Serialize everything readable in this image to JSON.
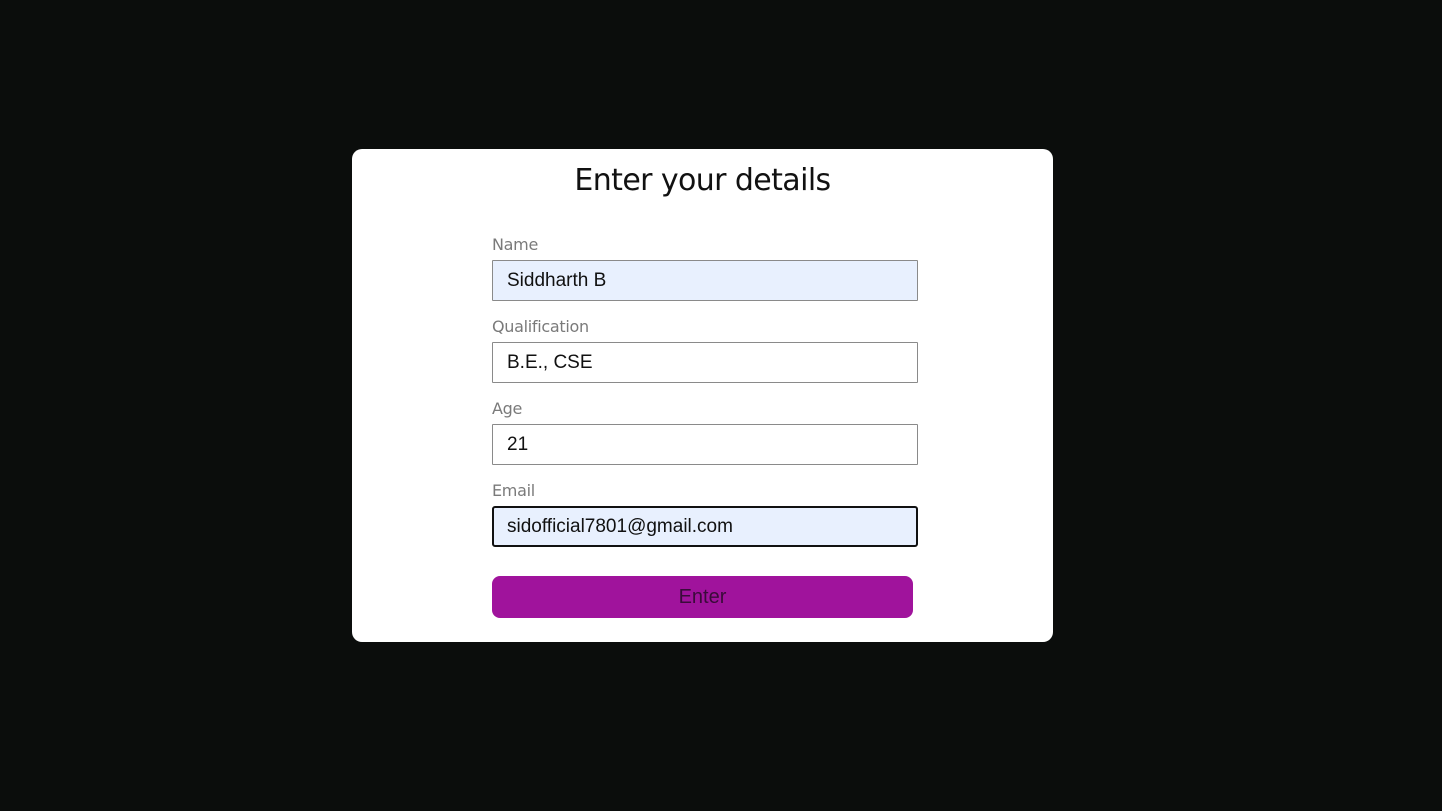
{
  "form": {
    "title": "Enter your details",
    "fields": [
      {
        "label": "Name",
        "value": "Siddharth B",
        "state": "autofilled"
      },
      {
        "label": "Qualification",
        "value": "B.E., CSE",
        "state": "default"
      },
      {
        "label": "Age",
        "value": "21",
        "state": "default"
      },
      {
        "label": "Email",
        "value": "sidofficial7801@gmail.com",
        "state": "autofilled-focused"
      }
    ],
    "submit_label": "Enter"
  },
  "colors": {
    "page_background": "#0b0d0c",
    "card_background": "#ffffff",
    "button_background": "#a0139c",
    "autofill_background": "#e8f0fe"
  }
}
